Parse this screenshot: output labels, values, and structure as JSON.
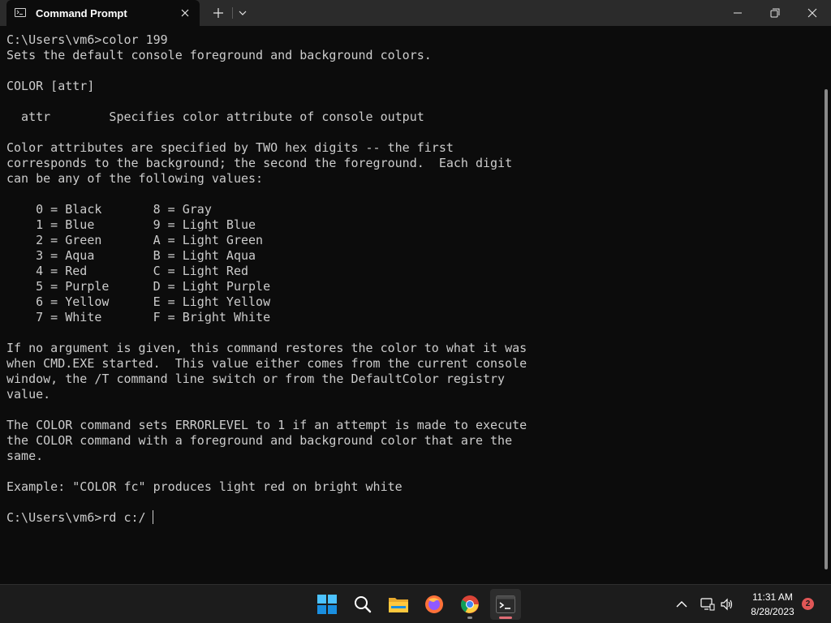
{
  "window": {
    "tab_title": "Command Prompt",
    "tab_icon": "cmd-icon"
  },
  "titlebar_buttons": {
    "new_tab_icon": "plus-icon",
    "dropdown_icon": "chevron-down-icon",
    "minimize_icon": "minimize-icon",
    "maximize_icon": "maximize-icon",
    "close_icon": "close-icon"
  },
  "console": {
    "output": "C:\\Users\\vm6>color 199\nSets the default console foreground and background colors.\n\nCOLOR [attr]\n\n  attr        Specifies color attribute of console output\n\nColor attributes are specified by TWO hex digits -- the first\ncorresponds to the background; the second the foreground.  Each digit\ncan be any of the following values:\n\n    0 = Black       8 = Gray\n    1 = Blue        9 = Light Blue\n    2 = Green       A = Light Green\n    3 = Aqua        B = Light Aqua\n    4 = Red         C = Light Red\n    5 = Purple      D = Light Purple\n    6 = Yellow      E = Light Yellow\n    7 = White       F = Bright White\n\nIf no argument is given, this command restores the color to what it was\nwhen CMD.EXE started.  This value either comes from the current console\nwindow, the /T command line switch or from the DefaultColor registry\nvalue.\n\nThe COLOR command sets ERRORLEVEL to 1 if an attempt is made to execute\nthe COLOR command with a foreground and background color that are the\nsame.\n\nExample: \"COLOR fc\" produces light red on bright white",
    "prompt": "C:\\Users\\vm6>",
    "current_input": "rd c:/"
  },
  "taskbar": {
    "apps": [
      {
        "name": "start",
        "icon": "windows-start-icon"
      },
      {
        "name": "search",
        "icon": "search-icon"
      },
      {
        "name": "file-explorer",
        "icon": "folder-icon"
      },
      {
        "name": "firefox",
        "icon": "firefox-icon"
      },
      {
        "name": "chrome",
        "icon": "chrome-icon"
      },
      {
        "name": "terminal",
        "icon": "terminal-icon"
      }
    ],
    "tray": {
      "chevron_icon": "chevron-up-icon",
      "network_icon": "network-icon",
      "volume_icon": "volume-icon",
      "time": "11:31 AM",
      "date": "8/28/2023",
      "notification_count": "2"
    }
  },
  "colors": {
    "console_bg": "#0c0c0c",
    "console_fg": "#cccccc",
    "titlebar_bg": "#2b2b2b",
    "taskbar_bg": "#1c1c1c",
    "notification_badge": "#e05656"
  }
}
